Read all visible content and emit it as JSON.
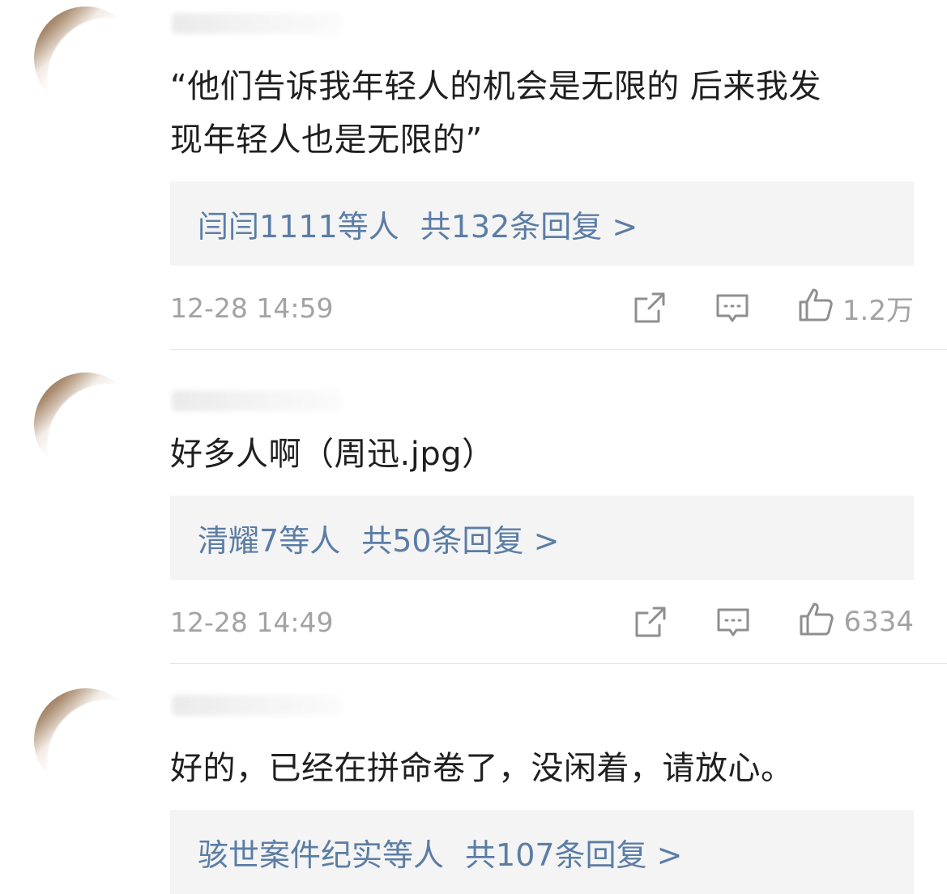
{
  "comments": [
    {
      "text_line1": "“他们告诉我年轻人的机会是无限的 后来我发",
      "text_line2": "现年轻人也是无限的”",
      "reply_names": "闫闫1111",
      "reply_suffix": "等人",
      "reply_total": "共132条回复 >",
      "time": "12-28 14:59",
      "likes": "1.2万"
    },
    {
      "text_line1": "好多人啊（周迅.jpg）",
      "text_line2": "",
      "reply_names": "清耀7",
      "reply_suffix": "等人",
      "reply_total": "共50条回复 >",
      "time": "12-28 14:49",
      "likes": "6334"
    },
    {
      "text_line1": "好的，已经在拼命卷了，没闲着，请放心。",
      "text_line2": "",
      "reply_names": "骇世案件纪实",
      "reply_suffix": "等人",
      "reply_total": "共107条回复 >",
      "time": "",
      "likes": ""
    }
  ],
  "icons": {
    "share": "share-icon",
    "reply": "comment-icon",
    "like": "thumbs-up-icon"
  },
  "colors": {
    "link": "#5b7da5",
    "meta": "#a3a3a3",
    "reply_bg": "#f4f4f4"
  }
}
